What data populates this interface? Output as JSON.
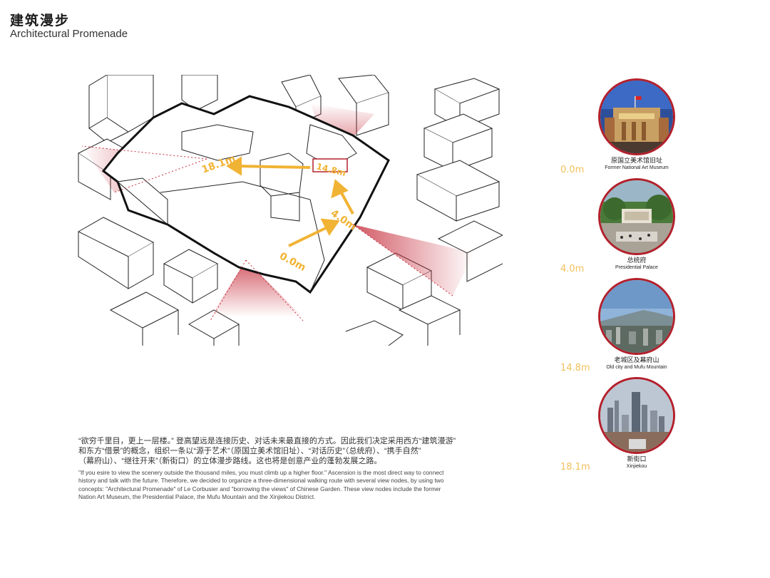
{
  "header": {
    "title_cn": "建筑漫步",
    "title_en": "Architectural Promenade"
  },
  "diagram": {
    "route_labels": [
      "0.0m",
      "4.0m",
      "14.8m",
      "18.1m"
    ],
    "colors": {
      "route_arrow": "#f1b334",
      "view_cone": "#c62e3c",
      "outline": "#111111"
    }
  },
  "description": {
    "cn_lines": [
      "“欲穷千里目，更上一层楼。” 登高望远是连接历史、对话未来最直接的方式。因此我们决定采用西方“建筑漫游”",
      "和东方“借景”的概念，组织一条以“源于艺术”（原国立美术馆旧址）、“对话历史”（总统府）、“携手自然”",
      "（幕府山）、“继往开来”（新街口）的立体漫步路线。这也将是创意产业的蓬勃发展之路。"
    ],
    "en_lines": [
      "\"If you esire to view the scenery outside the thousand miles, you must climb up a higher floor.\" Ascension is the most direct way to connect",
      "history and talk with the future. Therefore, we decided to organize a three-dimensional walking route with several view nodes, by using two",
      "concepts: \"Architectural Promenade\" of Le Corbusier and \"borrowing the views\" of Chinese Garden. These view nodes include the former",
      "Nation Art Museum, the Presidential Palace, the Mufu Mountain and the Xinjiekou District."
    ]
  },
  "view_nodes": [
    {
      "height": "0.0m",
      "caption_cn": "原国立美术馆旧址",
      "caption_en": "Former National Art Museum",
      "photo": "museum-photo-icon"
    },
    {
      "height": "4.0m",
      "caption_cn": "总统府",
      "caption_en": "Presidential Palace",
      "photo": "palace-photo-icon"
    },
    {
      "height": "14.8m",
      "caption_cn": "老城区及幕府山",
      "caption_en": "Old city and Mufu Mountain",
      "photo": "mountain-photo-icon"
    },
    {
      "height": "18.1m",
      "caption_cn": "新街口",
      "caption_en": "Xinjiekou",
      "photo": "skyline-photo-icon"
    }
  ]
}
